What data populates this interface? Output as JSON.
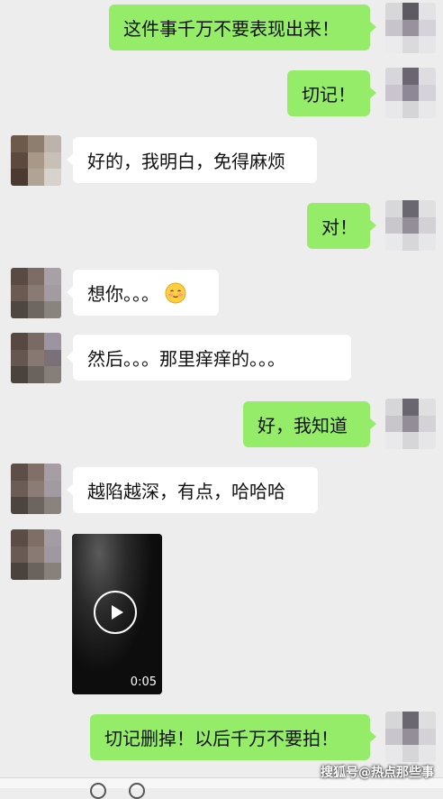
{
  "messages": [
    {
      "id": "m1",
      "side": "out",
      "text": "这件事千万不要表现出来！"
    },
    {
      "id": "m2",
      "side": "out",
      "text": "切记！"
    },
    {
      "id": "m3",
      "side": "in",
      "text": "好的，我明白，免得麻烦"
    },
    {
      "id": "m4",
      "side": "out",
      "text": "对！"
    },
    {
      "id": "m5",
      "side": "in",
      "text": "想你。。。",
      "emoji": "smiling-face-emoji"
    },
    {
      "id": "m6",
      "side": "in",
      "text": "然后。。。那里痒痒的。。。"
    },
    {
      "id": "m7",
      "side": "out",
      "text": "好，我知道"
    },
    {
      "id": "m8",
      "side": "in",
      "text": "越陷越深，有点，哈哈哈"
    },
    {
      "id": "m9",
      "side": "in",
      "type": "video",
      "duration": "0:05",
      "icon": "play-icon"
    },
    {
      "id": "m10",
      "side": "out",
      "text": "切记删掉！以后千万不要拍！"
    }
  ],
  "watermark": "搜狐号@热点那些事",
  "colors": {
    "background": "#ededed",
    "outgoing_bubble": "#95ec69",
    "incoming_bubble": "#ffffff"
  }
}
